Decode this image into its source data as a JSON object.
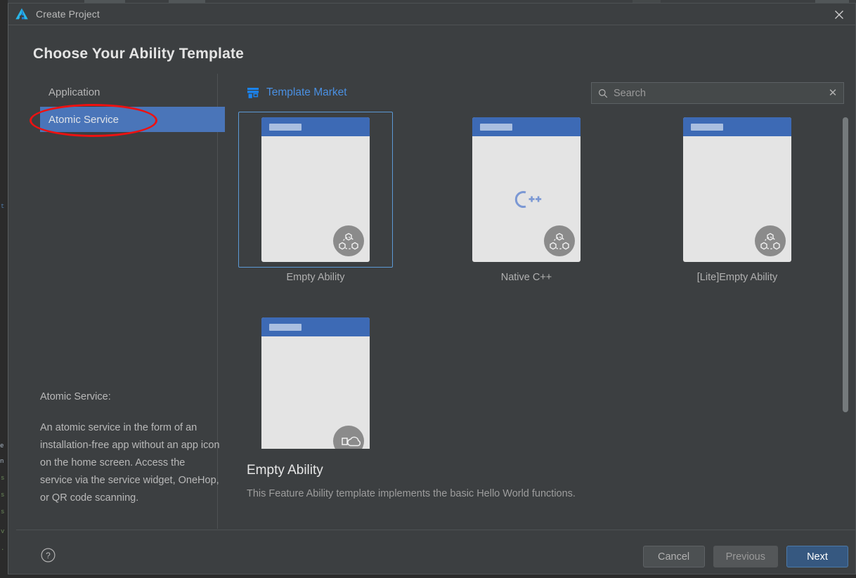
{
  "window": {
    "title": "Create Project",
    "logo_icon": "deveco-studio-logo",
    "close_icon": "close-icon"
  },
  "page_title": "Choose Your Ability Template",
  "sidebar": {
    "items": [
      {
        "label": "Application",
        "selected": false
      },
      {
        "label": "Atomic Service",
        "selected": true
      }
    ],
    "description_heading": "Atomic Service:",
    "description_body": "An atomic service in the form of an installation-free app without an app icon on the home screen. Access the service via the service widget, OneHop, or QR code scanning."
  },
  "annotation": {
    "shape": "ellipse",
    "color": "#ee1111",
    "targets": "Atomic Service"
  },
  "toolbar": {
    "market_label": "Template Market",
    "market_icon": "storefront-icon",
    "market_color": "#4a90e2"
  },
  "search": {
    "icon": "search-icon",
    "placeholder": "Search",
    "value": "",
    "clear_icon": "close-icon"
  },
  "templates": [
    {
      "label": "Empty Ability",
      "badge": "atomic-service-badge",
      "selected": true,
      "glyph": "none"
    },
    {
      "label": "Native C++",
      "badge": "atomic-service-badge",
      "selected": false,
      "glyph": "cpp"
    },
    {
      "label": "[Lite]Empty Ability",
      "badge": "atomic-service-badge",
      "selected": false,
      "glyph": "none"
    },
    {
      "label": "",
      "badge": "cloud-badge",
      "selected": false,
      "glyph": "none"
    }
  ],
  "selected_template": {
    "title": "Empty Ability",
    "description": "This Feature Ability template implements the basic Hello World functions."
  },
  "footer": {
    "help_icon": "help-circle-icon",
    "cancel_label": "Cancel",
    "previous_label": "Previous",
    "next_label": "Next"
  },
  "colors": {
    "dialog_bg": "#3c3f41",
    "selection_blue": "#4a75b9",
    "primary_button": "#365880",
    "accent_link": "#4a90e2",
    "card_selected_border": "#5c9ad6"
  }
}
